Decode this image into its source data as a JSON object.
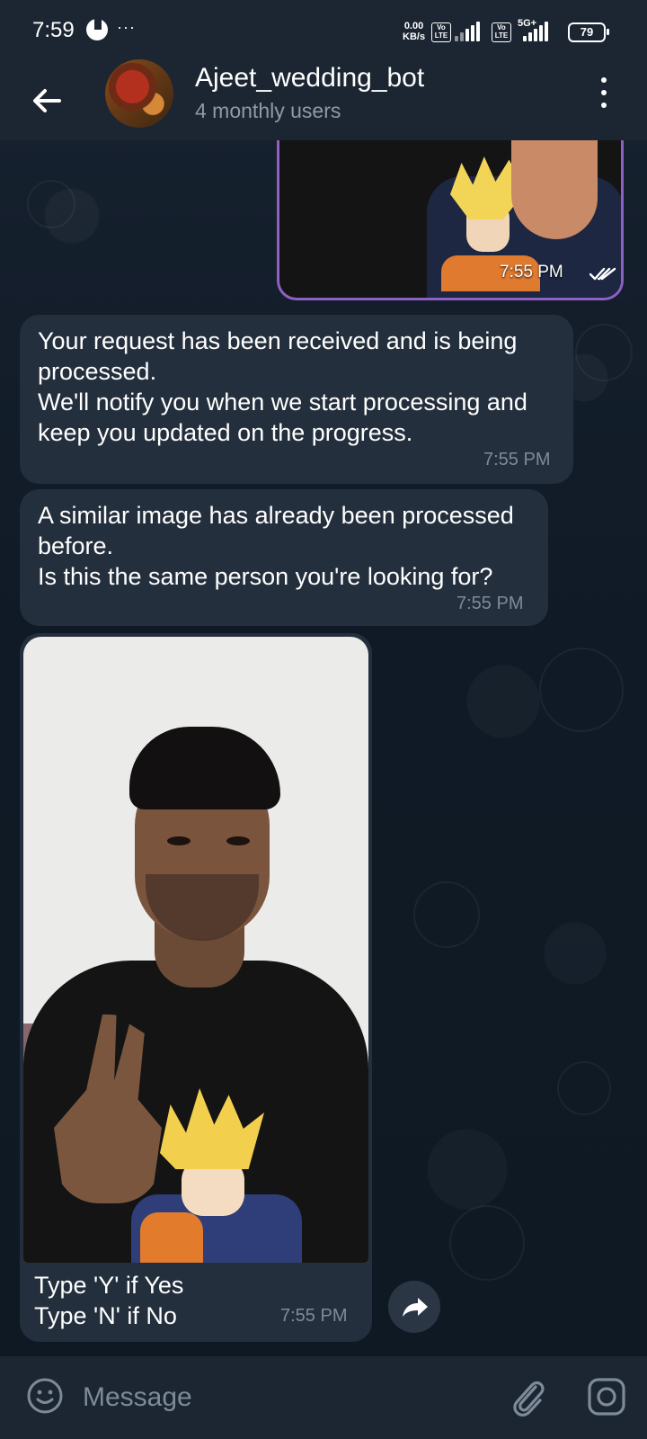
{
  "status_bar": {
    "time": "7:59",
    "more": "···",
    "net_speed_value": "0.00",
    "net_speed_unit": "KB/s",
    "sim1_badge": "Vo LTE",
    "sim2_badge": "Vo LTE",
    "network_type": "5G+",
    "battery": "79"
  },
  "header": {
    "title": "Ajeet_wedding_bot",
    "subtitle": "4 monthly users"
  },
  "messages": {
    "outgoing_photo_time": "7:55 PM",
    "bubble1_text": "Your request has been received and is being processed.\nWe'll notify you when we start processing and keep you updated on the progress.",
    "bubble1_time": "7:55 PM",
    "bubble2_text": "A similar image has already been processed before.\nIs this the same person you're looking for?",
    "bubble2_time": "7:55 PM",
    "photo_caption": "Type 'Y' if Yes\nType 'N' if No",
    "photo_time": "7:55 PM"
  },
  "input": {
    "placeholder": "Message"
  },
  "icons": [
    "back-arrow-icon",
    "more-vert-icon",
    "read-ticks-icon",
    "share-icon",
    "emoji-icon",
    "attach-icon",
    "camera-icon"
  ],
  "colors": {
    "background": "#0e1621",
    "header": "#1c2632",
    "incoming_bubble": "#242f3d",
    "outgoing_border": "#8e5fc4",
    "meta_text": "#7d8b99"
  }
}
